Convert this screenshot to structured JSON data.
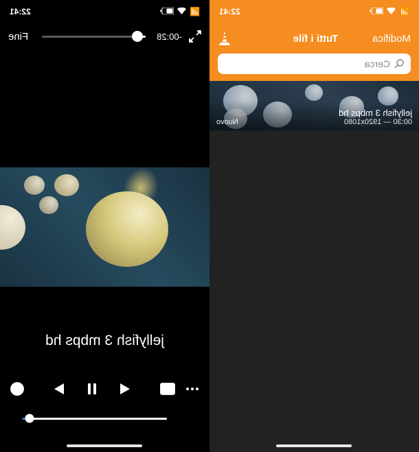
{
  "status": {
    "time": "22:41",
    "signal_icon": "signal-icon",
    "wifi_icon": "wifi-icon",
    "battery_icon": "battery-icon"
  },
  "list": {
    "edit_label": "Modifica",
    "title": "Tutti i file",
    "search_placeholder": "Cerca",
    "item": {
      "title": "jellyfish 3 mbps hd",
      "meta": "00:30 — 1920x1080",
      "badge": "Nuovo"
    }
  },
  "player": {
    "done_label": "Fine",
    "time_remaining": "-00:28",
    "video_title": "jellyfish 3 mbps hd"
  },
  "colors": {
    "accent": "#f58d20",
    "seek": "#2a6fd8"
  }
}
